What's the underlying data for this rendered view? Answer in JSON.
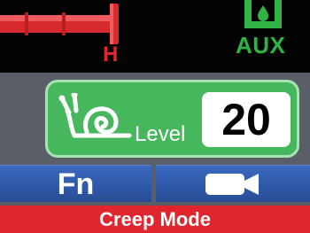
{
  "status_bar": {
    "gauge_letter": "H",
    "aux_label": "AUX",
    "icons": [
      "hydraulic-gauge-icon",
      "aux-drop-icon"
    ]
  },
  "creep_panel": {
    "icon": "snail-icon",
    "level_label": "Level",
    "level_value": "20"
  },
  "function_keys": [
    {
      "label": "Fn"
    },
    {
      "icon": "video-camera-icon"
    }
  ],
  "mode_bar": {
    "label": "Creep Mode"
  },
  "colors": {
    "red": "#e1252d",
    "green": "#47b75e",
    "blue": "#2f58a8",
    "aux_green": "#2fb344",
    "background": "#5a5f67"
  }
}
